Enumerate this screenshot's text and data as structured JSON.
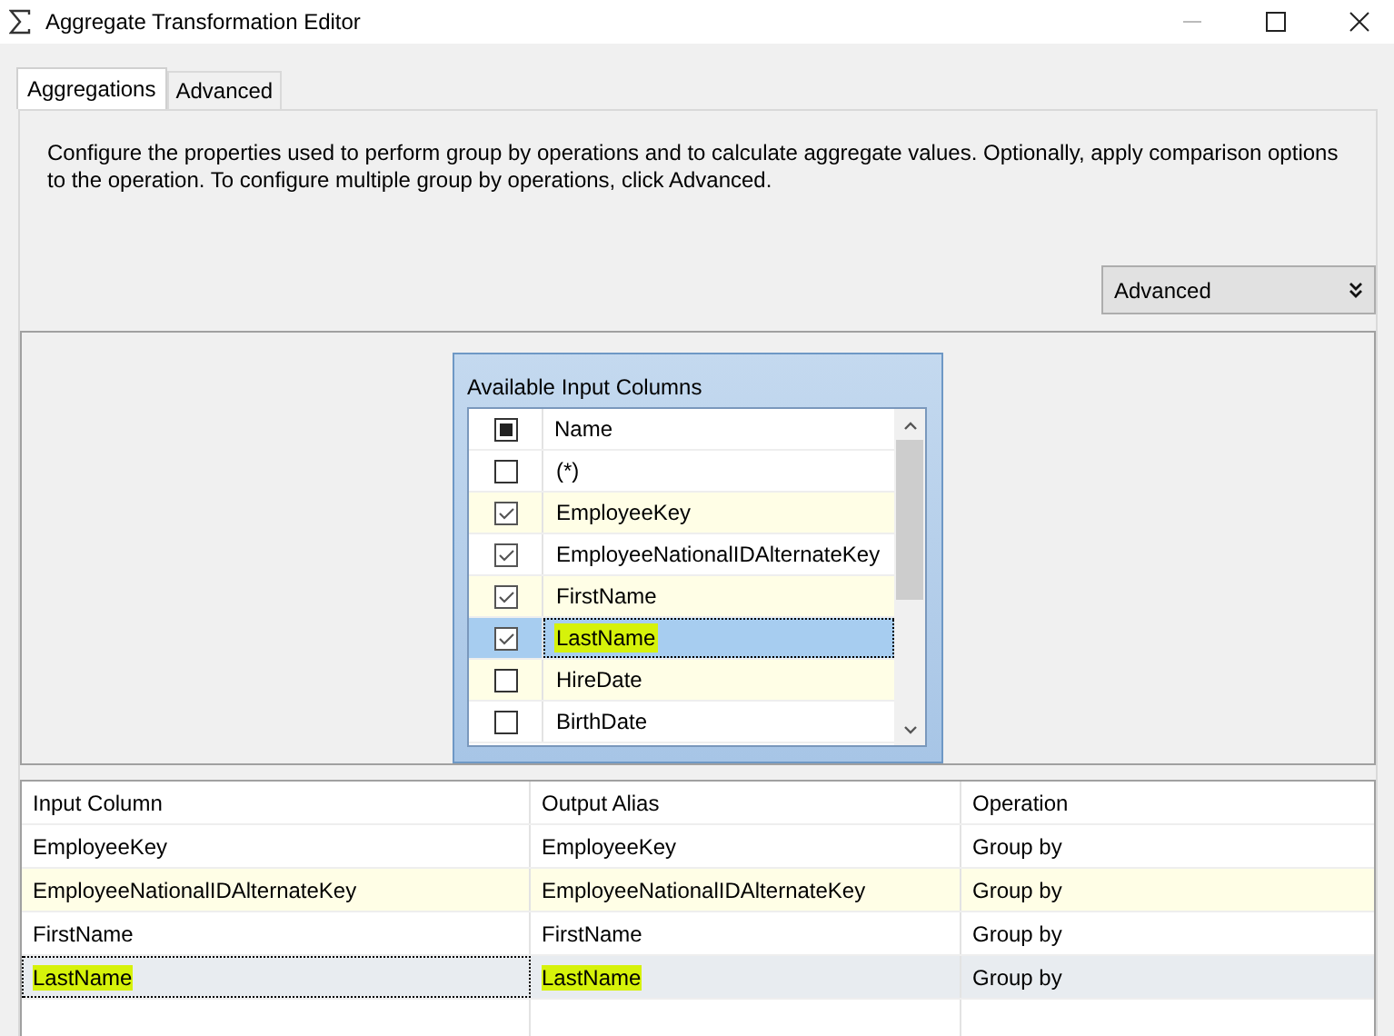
{
  "window": {
    "title": "Aggregate Transformation Editor"
  },
  "tabs": [
    {
      "label": "Aggregations",
      "selected": true
    },
    {
      "label": "Advanced",
      "selected": false
    }
  ],
  "description": "Configure the properties used to perform group by operations and to calculate aggregate values. Optionally, apply comparison options to the operation. To configure multiple group by operations, click Advanced.",
  "advanced_button": {
    "label": "Advanced"
  },
  "input_columns": {
    "title": "Available Input Columns",
    "header": "Name",
    "header_checked": true,
    "rows": [
      {
        "name": "(*)",
        "checked": false,
        "selected": false,
        "highlighted": false
      },
      {
        "name": "EmployeeKey",
        "checked": true,
        "selected": false,
        "highlighted": false
      },
      {
        "name": "EmployeeNationalIDAlternateKey",
        "checked": true,
        "selected": false,
        "highlighted": false
      },
      {
        "name": "FirstName",
        "checked": true,
        "selected": false,
        "highlighted": false
      },
      {
        "name": "LastName",
        "checked": true,
        "selected": true,
        "highlighted": true
      },
      {
        "name": "HireDate",
        "checked": false,
        "selected": false,
        "highlighted": false
      },
      {
        "name": "BirthDate",
        "checked": false,
        "selected": false,
        "highlighted": false
      }
    ]
  },
  "table": {
    "columns": [
      "Input Column",
      "Output Alias",
      "Operation"
    ],
    "rows": [
      {
        "cells": [
          "EmployeeKey",
          "EmployeeKey",
          "Group by"
        ],
        "selected": false,
        "highlighted": false
      },
      {
        "cells": [
          "EmployeeNationalIDAlternateKey",
          "EmployeeNationalIDAlternateKey",
          "Group by"
        ],
        "selected": false,
        "highlighted": false
      },
      {
        "cells": [
          "FirstName",
          "FirstName",
          "Group by"
        ],
        "selected": false,
        "highlighted": false
      },
      {
        "cells": [
          "LastName",
          "LastName",
          "Group by"
        ],
        "selected": true,
        "highlighted": true
      }
    ]
  }
}
